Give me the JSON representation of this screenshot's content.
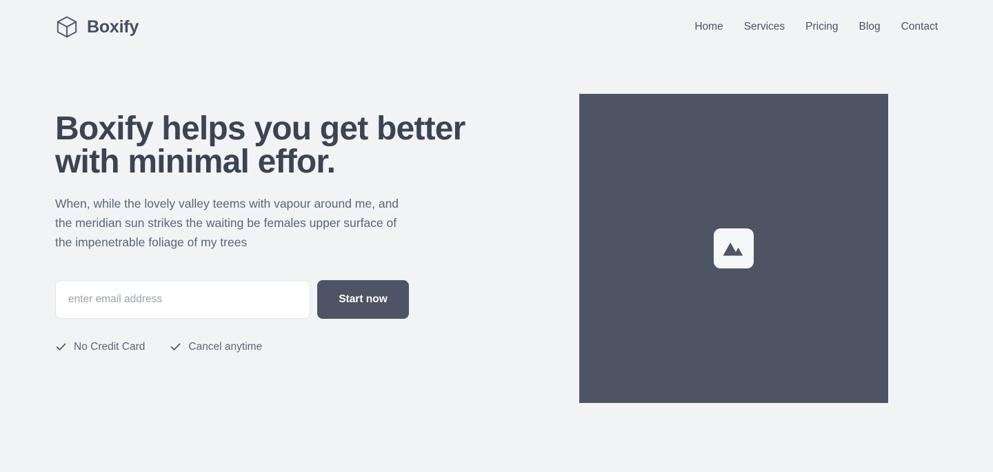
{
  "brand": {
    "name": "Boxify",
    "logo_icon": "cube-icon",
    "logo_color": "#454f61"
  },
  "nav": {
    "items": [
      {
        "label": "Home"
      },
      {
        "label": "Services"
      },
      {
        "label": "Pricing"
      },
      {
        "label": "Blog"
      },
      {
        "label": "Contact"
      }
    ]
  },
  "hero": {
    "title": "Boxify helps you get better\nwith minimal effor.",
    "subtitle": "When, while the lovely valley teems with vapour around me, and\nthe meridian sun strikes the waiting be females upper surface of\nthe impenetrable foliage of my trees",
    "form": {
      "email_placeholder": "enter email address",
      "email_value": "",
      "submit_label": "Start now"
    },
    "features": [
      {
        "icon": "check-icon",
        "label": "No Credit Card"
      },
      {
        "icon": "check-icon",
        "label": "Cancel anytime"
      }
    ],
    "media": {
      "icon": "image-placeholder-icon",
      "panel_color": "#4d5564",
      "badge_color": "#f6f7f9"
    }
  },
  "theme": {
    "background": "#f2f3f5",
    "text_dark": "#3c4453",
    "text_muted": "#5c6577",
    "accent": "#4c5465"
  }
}
